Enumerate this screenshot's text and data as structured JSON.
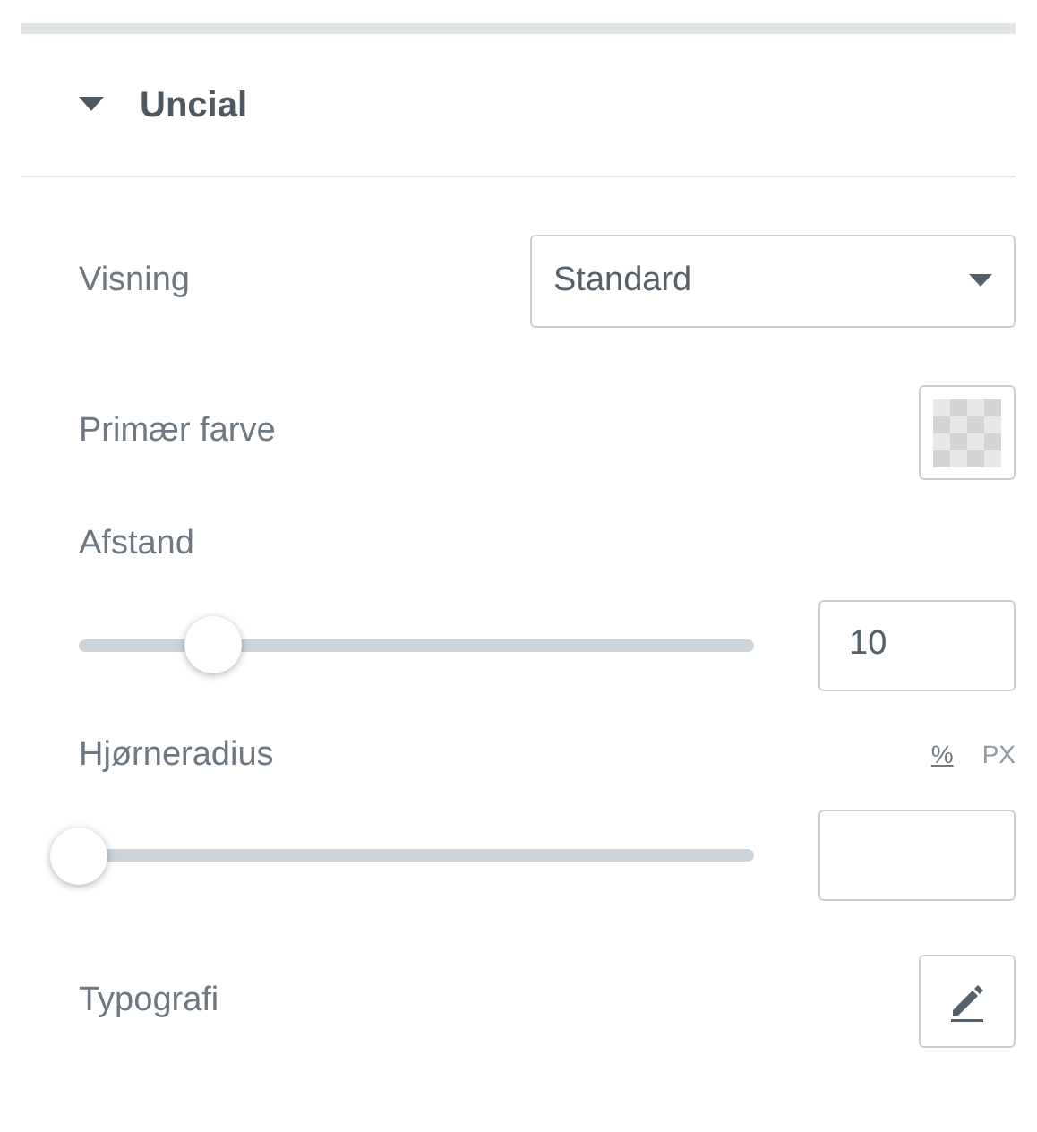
{
  "section": {
    "title": "Uncial",
    "expanded": true
  },
  "controls": [
    {
      "kind": "select",
      "label": "Visning",
      "value": "Standard"
    },
    {
      "kind": "color",
      "label": "Primær farve"
    },
    {
      "kind": "slider",
      "label": "Afstand",
      "level": 0.2,
      "value": "10"
    },
    {
      "kind": "slider",
      "label": "Hjørneradius",
      "level": 0,
      "units": [
        {
          "label": "%",
          "selected": true
        },
        {
          "label": "PX",
          "selected": false
        }
      ]
    },
    {
      "kind": "edit",
      "label": "Typografi"
    }
  ]
}
